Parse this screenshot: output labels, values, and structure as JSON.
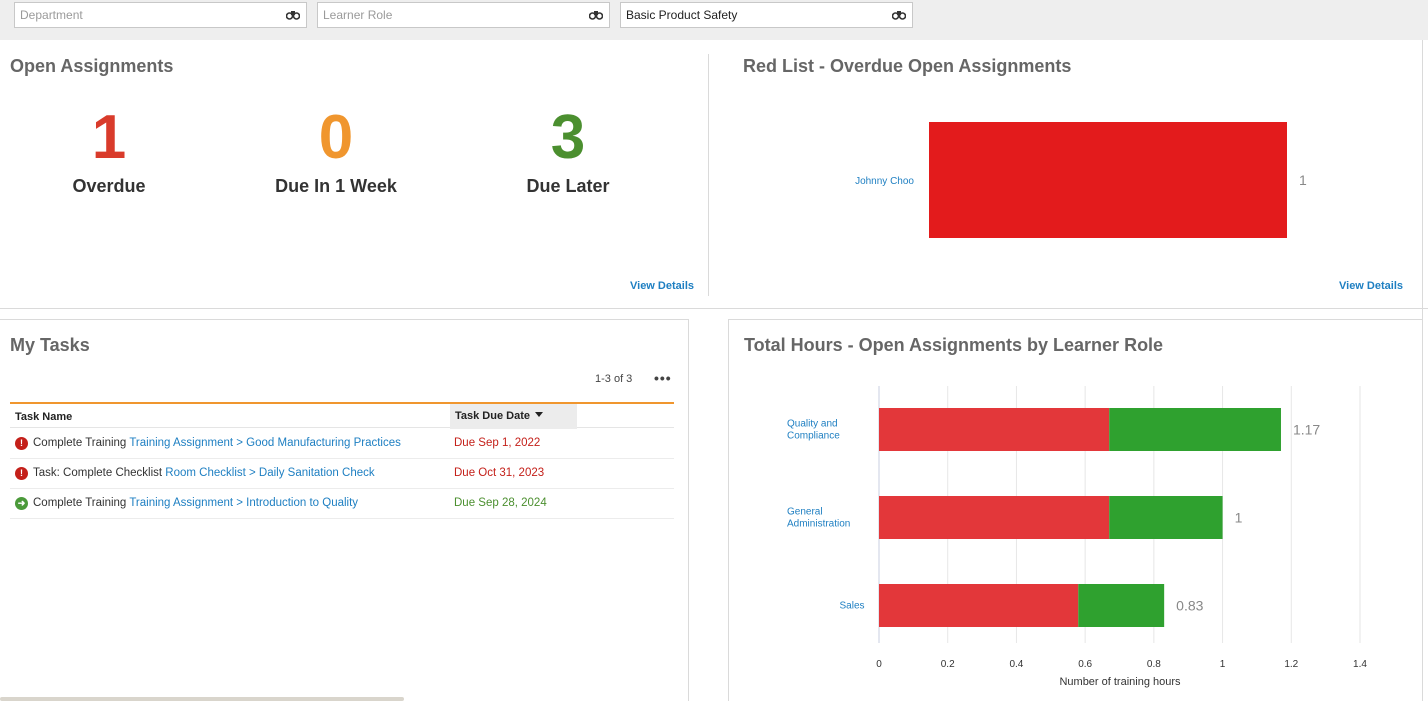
{
  "filters": {
    "department": {
      "placeholder": "Department",
      "value": ""
    },
    "learner_role": {
      "placeholder": "Learner Role",
      "value": ""
    },
    "product": {
      "placeholder": "",
      "value": "Basic Product Safety"
    },
    "search_icon": "binoculars-icon"
  },
  "open_assignments": {
    "title": "Open Assignments",
    "kpis": [
      {
        "value": "1",
        "label": "Overdue",
        "color": "#d93b2b"
      },
      {
        "value": "0",
        "label": "Due In 1 Week",
        "color": "#f0962e"
      },
      {
        "value": "3",
        "label": "Due Later",
        "color": "#4b8f2f"
      }
    ],
    "view_details": "View Details"
  },
  "red_list": {
    "title": "Red List - Overdue Open Assignments",
    "view_details": "View Details"
  },
  "my_tasks": {
    "title": "My Tasks",
    "pager": "1-3 of 3",
    "more_label": "•••",
    "columns": [
      "Task Name",
      "Task Due Date"
    ],
    "rows": [
      {
        "status": "overdue",
        "status_icon": "!",
        "status_color": "#c4201a",
        "prefix": "Complete Training ",
        "link": "Training Assignment > Good Manufacturing Practices",
        "due": "Due Sep 1, 2022",
        "due_color": "#c4201a"
      },
      {
        "status": "overdue",
        "status_icon": "!",
        "status_color": "#c4201a",
        "prefix": "Task: Complete Checklist ",
        "link": "Room Checklist > Daily Sanitation Check",
        "due": "Due Oct 31, 2023",
        "due_color": "#c4201a"
      },
      {
        "status": "on-track",
        "status_icon": "➜",
        "status_color": "#4b9a3a",
        "prefix": "Complete Training ",
        "link": "Training Assignment > Introduction to Quality",
        "due": "Due Sep 28, 2024",
        "due_color": "#4b8f2f"
      }
    ]
  },
  "total_hours": {
    "title": "Total Hours - Open Assignments by Learner Role"
  },
  "chart_data": [
    {
      "type": "bar",
      "orientation": "horizontal",
      "title": "Red List - Overdue Open Assignments",
      "categories": [
        "Johnny Choo"
      ],
      "values": [
        1
      ],
      "data_labels": [
        "1"
      ],
      "xlim": [
        0,
        1
      ],
      "color": "#e31b1c"
    },
    {
      "type": "bar",
      "orientation": "horizontal",
      "stacked": true,
      "title": "Total Hours - Open Assignments by Learner Role",
      "categories": [
        [
          "Quality and",
          "Compliance"
        ],
        [
          "General",
          "Administration"
        ],
        [
          "Sales"
        ]
      ],
      "series": [
        {
          "values": [
            0.67,
            0.67,
            0.58
          ],
          "color": "#e3373a"
        },
        {
          "values": [
            0.5,
            0.33,
            0.25
          ],
          "color": "#2fa12f"
        }
      ],
      "totals": [
        1.17,
        1,
        0.83
      ],
      "data_labels": [
        "1.17",
        "1",
        "0.83"
      ],
      "xlabel": "Number of training hours",
      "xticks": [
        0,
        0.2,
        0.4,
        0.6,
        0.8,
        1,
        1.2,
        1.4
      ],
      "xlim": [
        0,
        1.4
      ],
      "grid": true
    }
  ]
}
